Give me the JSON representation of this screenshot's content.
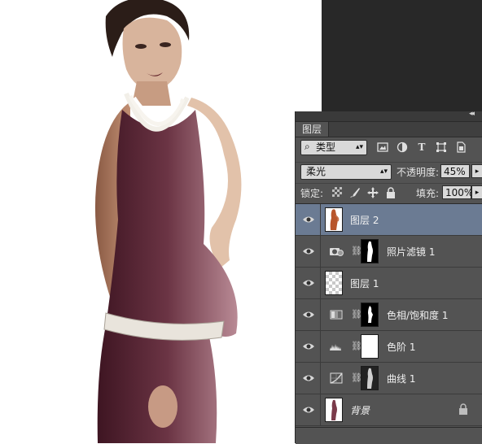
{
  "panel": {
    "tab_title": "图层",
    "filter_select": "类型",
    "filter_icons": [
      "image-filter-icon",
      "adjustment-filter-icon",
      "type-filter-icon",
      "shape-filter-icon",
      "smart-object-filter-icon"
    ],
    "filter_type_glyph": "T",
    "blend_mode": "柔光",
    "opacity_label": "不透明度:",
    "opacity_value": "45%",
    "lock_label": "锁定:",
    "fill_label": "填充:",
    "fill_value": "100%"
  },
  "layers": [
    {
      "name": "图层 2",
      "selected": true,
      "kind": "pixel"
    },
    {
      "name": "照片滤镜 1",
      "selected": false,
      "kind": "adjustment",
      "icon": "photo-filter-icon"
    },
    {
      "name": "图层 1",
      "selected": false,
      "kind": "pixel-transparent"
    },
    {
      "name": "色相/饱和度 1",
      "selected": false,
      "kind": "adjustment",
      "icon": "hue-saturation-icon"
    },
    {
      "name": "色阶 1",
      "selected": false,
      "kind": "adjustment",
      "icon": "levels-icon"
    },
    {
      "name": "曲线 1",
      "selected": false,
      "kind": "adjustment",
      "icon": "curves-icon"
    },
    {
      "name": "背景",
      "selected": false,
      "kind": "background",
      "locked": true
    }
  ],
  "colors": {
    "panel_bg": "#535353",
    "selected_row": "#6b7b93",
    "workspace_bg": "#282828",
    "dress": "#5e2a3a"
  }
}
